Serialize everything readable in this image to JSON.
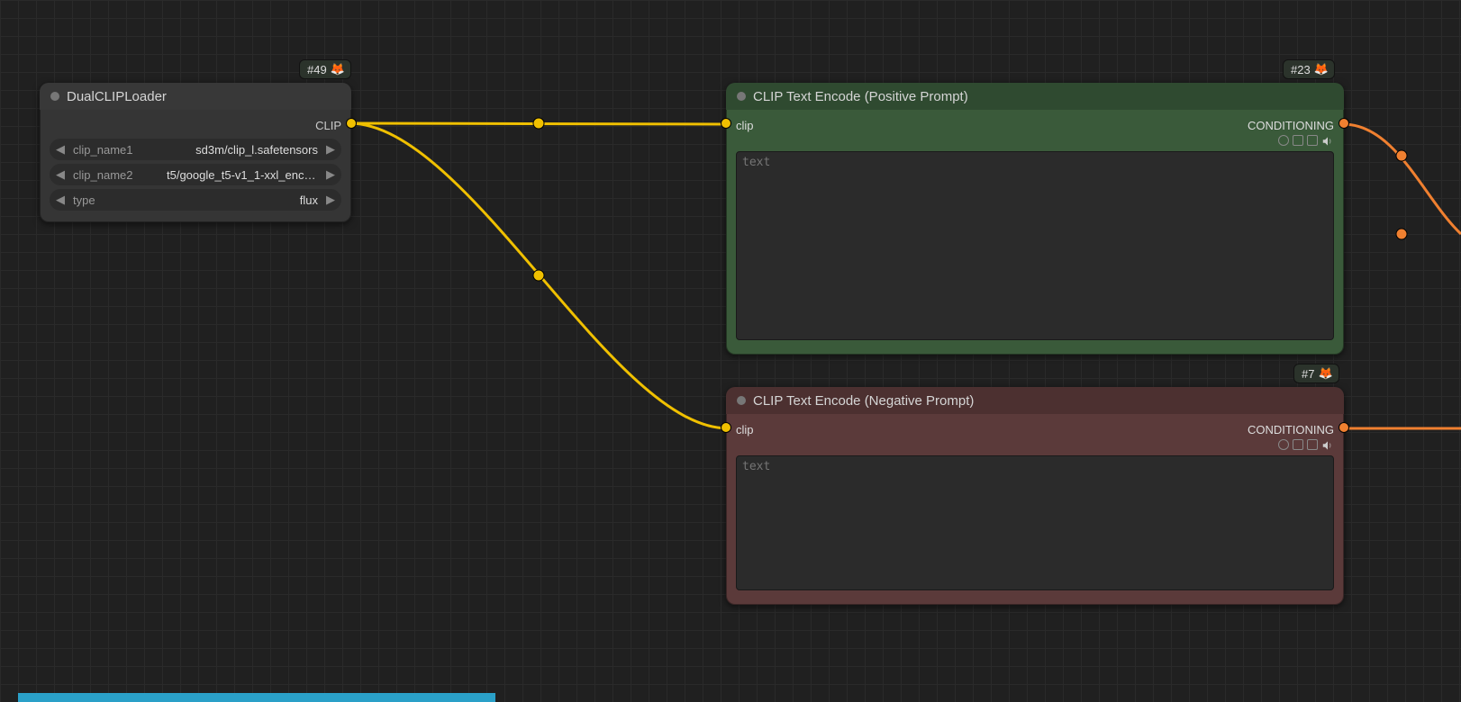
{
  "badges": {
    "loader": {
      "label": "#49",
      "emoji": "🦊"
    },
    "positive": {
      "label": "#23",
      "emoji": "🦊"
    },
    "negative": {
      "label": "#7",
      "emoji": "🦊"
    }
  },
  "loader": {
    "title": "DualCLIPLoader",
    "output_label": "CLIP",
    "widgets": {
      "clip_name1": {
        "name": "clip_name1",
        "value": "sd3m/clip_l.safetensors"
      },
      "clip_name2": {
        "name": "clip_name2",
        "value": "t5/google_t5-v1_1-xxl_enco…"
      },
      "type": {
        "name": "type",
        "value": "flux"
      }
    }
  },
  "positive": {
    "title": "CLIP Text Encode (Positive Prompt)",
    "input_label": "clip",
    "output_label": "CONDITIONING",
    "text_placeholder": "text",
    "text_value": ""
  },
  "negative": {
    "title": "CLIP Text Encode (Negative Prompt)",
    "input_label": "clip",
    "output_label": "CONDITIONING",
    "text_placeholder": "text",
    "text_value": ""
  }
}
